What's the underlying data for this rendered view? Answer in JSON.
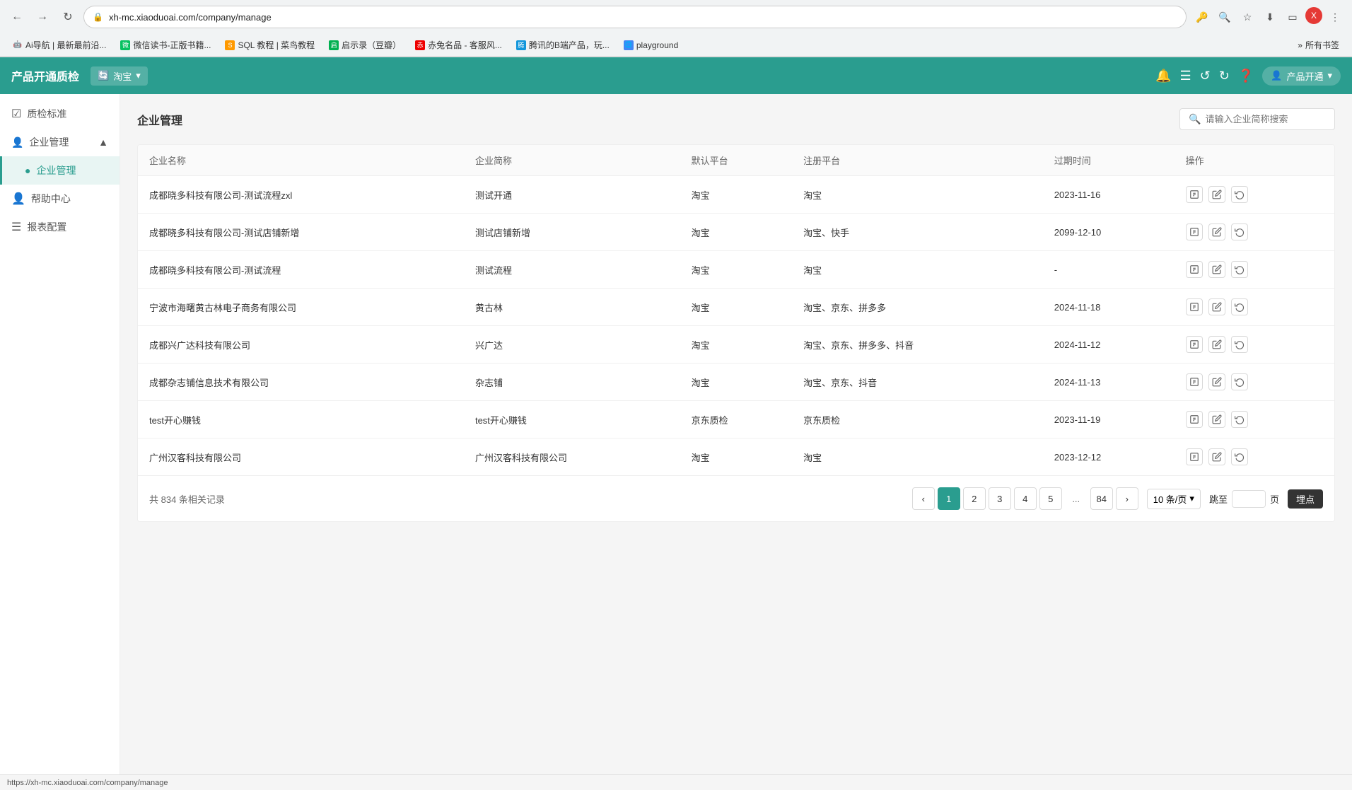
{
  "browser": {
    "url": "xh-mc.xiaoduoai.com/company/manage",
    "statusbar_url": "https://xh-mc.xiaoduoai.com/company/manage"
  },
  "bookmarks": [
    {
      "id": "bm1",
      "label": "Ai导航 | 最新最前沿...",
      "favicon": "🤖"
    },
    {
      "id": "bm2",
      "label": "微信读书-正版书籍...",
      "favicon": "📖",
      "color": "#07C160"
    },
    {
      "id": "bm3",
      "label": "SQL 教程 | 菜鸟教程",
      "favicon": "🐦",
      "color": "#f90"
    },
    {
      "id": "bm4",
      "label": "启示录（豆瓣）",
      "favicon": "📗",
      "color": "#00b050"
    },
    {
      "id": "bm5",
      "label": "赤兔名品 - 客服风...",
      "favicon": "🐇",
      "color": "#e00"
    },
    {
      "id": "bm6",
      "label": "腾讯的B端产品，玩...",
      "favicon": "🐧",
      "color": "#1296db"
    },
    {
      "id": "bm7",
      "label": "playground",
      "favicon": "🌐",
      "color": "#4285f4"
    }
  ],
  "app": {
    "title": "产品开通质检",
    "platform": "淘宝",
    "user_label": "产品开通",
    "header_icons": [
      "bell",
      "list",
      "refresh-cw",
      "refresh",
      "help-circle"
    ]
  },
  "sidebar": {
    "items": [
      {
        "id": "quality-standard",
        "label": "质检标准",
        "icon": "☑",
        "active": false
      },
      {
        "id": "company-management-group",
        "label": "企业管理",
        "icon": "👤",
        "expanded": true
      },
      {
        "id": "company-management",
        "label": "企业管理",
        "icon": "●",
        "active": true,
        "sub": true
      },
      {
        "id": "help-center",
        "label": "帮助中心",
        "icon": "○",
        "active": false
      },
      {
        "id": "report-config",
        "label": "报表配置",
        "icon": "☰",
        "active": false
      }
    ]
  },
  "page": {
    "title": "企业管理",
    "search_placeholder": "请输入企业简称搜索"
  },
  "table": {
    "columns": [
      {
        "id": "company-name",
        "label": "企业名称"
      },
      {
        "id": "company-short",
        "label": "企业简称"
      },
      {
        "id": "default-platform",
        "label": "默认平台"
      },
      {
        "id": "register-platform",
        "label": "注册平台"
      },
      {
        "id": "expire-time",
        "label": "过期时间"
      },
      {
        "id": "actions",
        "label": "操作"
      }
    ],
    "rows": [
      {
        "id": "row1",
        "company_name": "成都晓多科技有限公司-测试流程zxl",
        "company_short": "测试开通",
        "default_platform": "淘宝",
        "register_platform": "淘宝",
        "expire_time": "2023-11-16"
      },
      {
        "id": "row2",
        "company_name": "成都晓多科技有限公司-测试店铺新增",
        "company_short": "测试店铺新增",
        "default_platform": "淘宝",
        "register_platform": "淘宝、快手",
        "expire_time": "2099-12-10"
      },
      {
        "id": "row3",
        "company_name": "成都晓多科技有限公司-测试流程",
        "company_short": "测试流程",
        "default_platform": "淘宝",
        "register_platform": "淘宝",
        "expire_time": "-"
      },
      {
        "id": "row4",
        "company_name": "宁波市海曙黄古林电子商务有限公司",
        "company_short": "黄古林",
        "default_platform": "淘宝",
        "register_platform": "淘宝、京东、拼多多",
        "expire_time": "2024-11-18"
      },
      {
        "id": "row5",
        "company_name": "成都兴广达科技有限公司",
        "company_short": "兴广达",
        "default_platform": "淘宝",
        "register_platform": "淘宝、京东、拼多多、抖音",
        "expire_time": "2024-11-12"
      },
      {
        "id": "row6",
        "company_name": "成都杂志铺信息技术有限公司",
        "company_short": "杂志铺",
        "default_platform": "淘宝",
        "register_platform": "淘宝、京东、抖音",
        "expire_time": "2024-11-13"
      },
      {
        "id": "row7",
        "company_name": "test开心赚钱",
        "company_short": "test开心赚钱",
        "default_platform": "京东质检",
        "register_platform": "京东质检",
        "expire_time": "2023-11-19"
      },
      {
        "id": "row8",
        "company_name": "广州汉客科技有限公司",
        "company_short": "广州汉客科技有限公司",
        "default_platform": "淘宝",
        "register_platform": "淘宝",
        "expire_time": "2023-12-12"
      }
    ]
  },
  "pagination": {
    "total_text": "共 834 条相关记录",
    "pages": [
      "1",
      "2",
      "3",
      "4",
      "5"
    ],
    "ellipsis": "...",
    "last_page": "84",
    "current_page": "1",
    "per_page_label": "10 条/页",
    "jump_label": "跳至",
    "page_label": "页",
    "confirm_label": "埋点"
  }
}
